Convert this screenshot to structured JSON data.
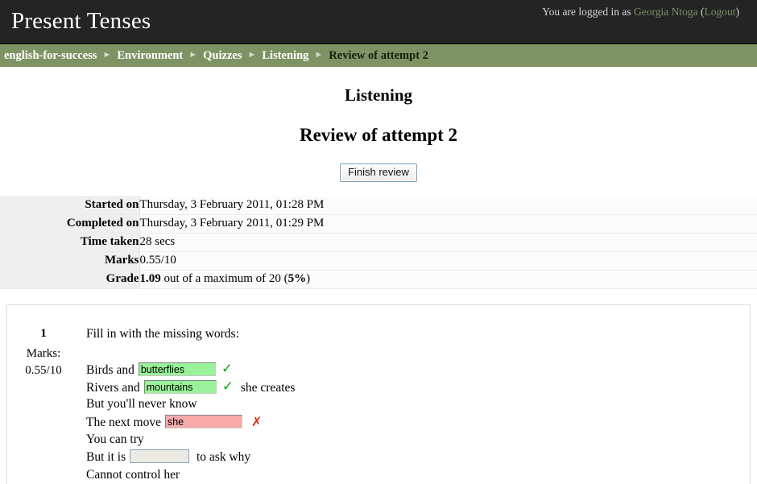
{
  "header": {
    "site_title": "Present Tenses",
    "login_prefix": "You are logged in as",
    "user_name": "Georgia Ntoga",
    "logout_open": "(",
    "logout_label": "Logout",
    "logout_close": ")"
  },
  "breadcrumb": {
    "separator": "►",
    "items": [
      {
        "label": "english-for-success",
        "current": false
      },
      {
        "label": "Environment",
        "current": false
      },
      {
        "label": "Quizzes",
        "current": false
      },
      {
        "label": "Listening",
        "current": false
      },
      {
        "label": "Review of attempt 2",
        "current": true
      }
    ]
  },
  "page": {
    "heading": "Listening",
    "subheading": "Review of attempt 2",
    "finish_button": "Finish review"
  },
  "summary": {
    "rows": [
      {
        "label": "Started on",
        "value": "Thursday, 3 February 2011, 01:28 PM"
      },
      {
        "label": "Completed on",
        "value": "Thursday, 3 February 2011, 01:29 PM"
      },
      {
        "label": "Time taken",
        "value": "28 secs"
      },
      {
        "label": "Marks",
        "value": "0.55/10"
      }
    ],
    "grade": {
      "label": "Grade",
      "score": "1.09",
      "middle_text": " out of a maximum of 20 (",
      "percent": "5%",
      "suffix": ")"
    }
  },
  "question": {
    "number": "1",
    "marks_label": "Marks:",
    "marks_value": "0.55/10",
    "prompt": "Fill in with the missing words:",
    "lines": [
      {
        "before": "Birds and",
        "answer": "butterflies",
        "state": "correct",
        "mark": "✓",
        "after": ""
      },
      {
        "before": "Rivers and",
        "answer": "mountains",
        "state": "correct",
        "mark": "✓",
        "after": "she creates"
      },
      {
        "before": "But you'll never know",
        "answer": null,
        "state": "none",
        "mark": "",
        "after": ""
      },
      {
        "before": "The next move",
        "answer": "she",
        "state": "wrong",
        "mark": "✗",
        "after": ""
      },
      {
        "before": "You can try",
        "answer": null,
        "state": "none",
        "mark": "",
        "after": ""
      },
      {
        "before": "But it is",
        "answer": "",
        "state": "empty",
        "mark": "",
        "after": "to ask why"
      },
      {
        "before": "Cannot control her",
        "answer": null,
        "state": "none",
        "mark": "",
        "after": ""
      }
    ]
  },
  "colors": {
    "header_bg": "#242424",
    "breadcrumb_bg": "#7e9363",
    "link_green": "#7b9065",
    "correct_fill": "#99f299",
    "wrong_fill": "#f8aaaa",
    "empty_fill": "#ebebe4",
    "check_green": "#0ba60b",
    "cross_red": "#e02b13"
  }
}
